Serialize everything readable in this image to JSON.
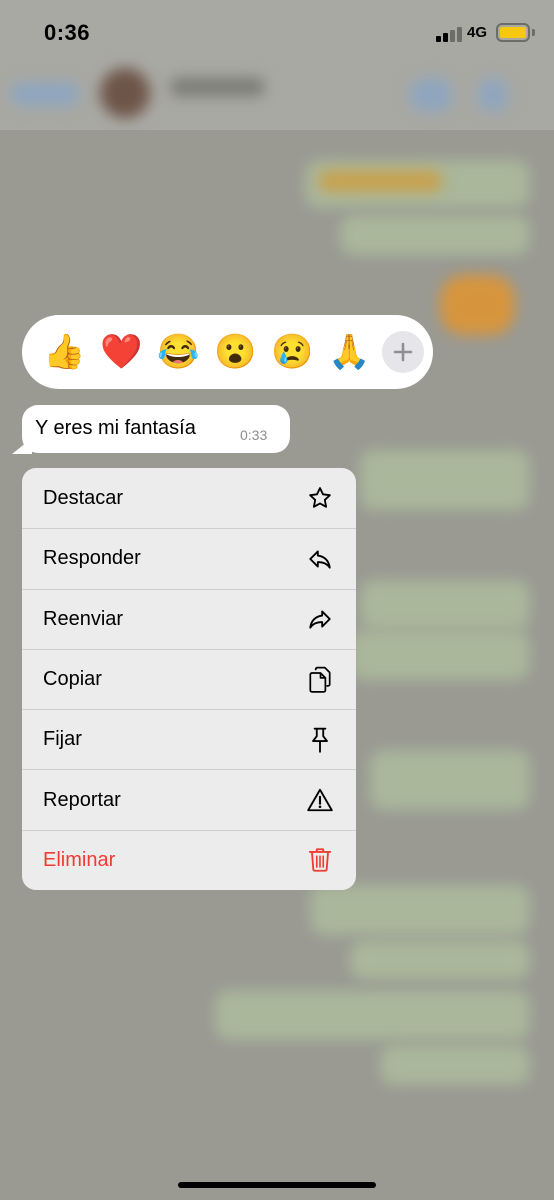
{
  "status_bar": {
    "time": "0:36",
    "network": "4G",
    "battery_color": "#f6c90e"
  },
  "reactions": [
    {
      "emoji": "👍",
      "name": "thumbs-up"
    },
    {
      "emoji": "❤️",
      "name": "red-heart"
    },
    {
      "emoji": "😂",
      "name": "tears-of-joy"
    },
    {
      "emoji": "😮",
      "name": "open-mouth"
    },
    {
      "emoji": "😢",
      "name": "crying-face"
    },
    {
      "emoji": "🙏",
      "name": "folded-hands"
    }
  ],
  "reaction_more_icon": "plus-icon",
  "message": {
    "text": "Y eres mi fantasía",
    "time": "0:33"
  },
  "menu": {
    "items": [
      {
        "label": "Destacar",
        "icon": "star-icon"
      },
      {
        "label": "Responder",
        "icon": "reply-icon"
      },
      {
        "label": "Reenviar",
        "icon": "forward-icon"
      },
      {
        "label": "Copiar",
        "icon": "copy-icon"
      },
      {
        "label": "Fijar",
        "icon": "pin-icon"
      },
      {
        "label": "Reportar",
        "icon": "warning-icon"
      },
      {
        "label": "Eliminar",
        "icon": "trash-icon"
      }
    ],
    "destructive_color": "#ef3b32"
  }
}
